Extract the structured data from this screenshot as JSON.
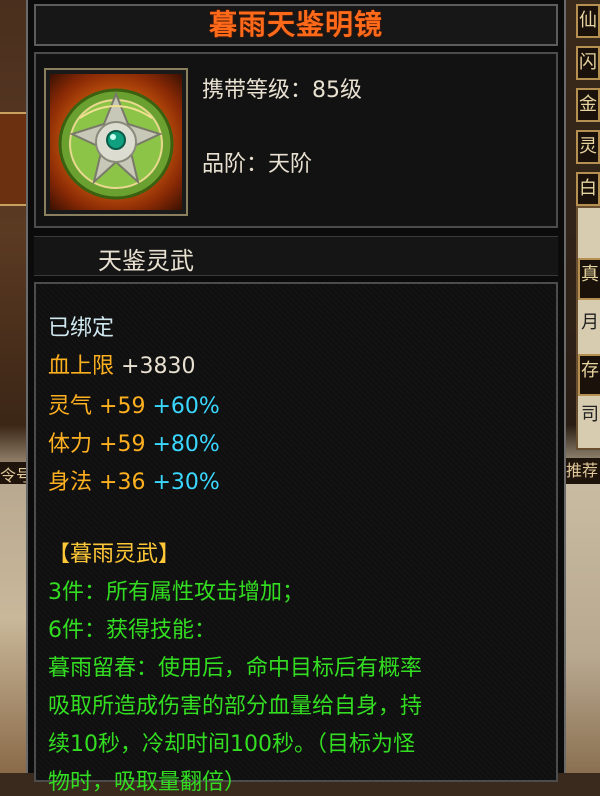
{
  "background": {
    "left_label": "令号",
    "right_tabs": [
      "仙",
      "闪",
      "金",
      "灵",
      "白"
    ],
    "right_panel_tabs": [
      "真",
      "月",
      "存",
      "司"
    ],
    "right_label": "推荐"
  },
  "item": {
    "name": "暮雨天鉴明镜",
    "carry_level_label": "携带等级：",
    "carry_level_value": "85级",
    "grade_label": "品阶：",
    "grade_value": "天阶",
    "category": "天鉴灵武",
    "icon": "jade-mirror-icon"
  },
  "stats": {
    "bound": "已绑定",
    "hp": {
      "label": "血上限",
      "value": "+3830"
    },
    "lingqi": {
      "label": "灵气",
      "value": "+59",
      "pct": "+60%"
    },
    "tili": {
      "label": "体力",
      "value": "+59",
      "pct": "+80%"
    },
    "shenfa": {
      "label": "身法",
      "value": "+36",
      "pct": "+30%"
    }
  },
  "set": {
    "name": "【暮雨灵武】",
    "bonus3": "3件：所有属性攻击增加；",
    "bonus6": "6件：获得技能：",
    "desc_line1": "暮雨留春：使用后，命中目标后有概率",
    "desc_line2": "吸取所造成伤害的部分血量给自身，持",
    "desc_line3": "续10秒，冷却时间100秒。（目标为怪",
    "desc_line4": "物时，吸取量翻倍）"
  },
  "colors": {
    "title": "#ff6a1a",
    "attribute": "#ffb020",
    "percent": "#3ad8ff",
    "set_text": "#33dd22",
    "set_name": "#ffc838"
  }
}
